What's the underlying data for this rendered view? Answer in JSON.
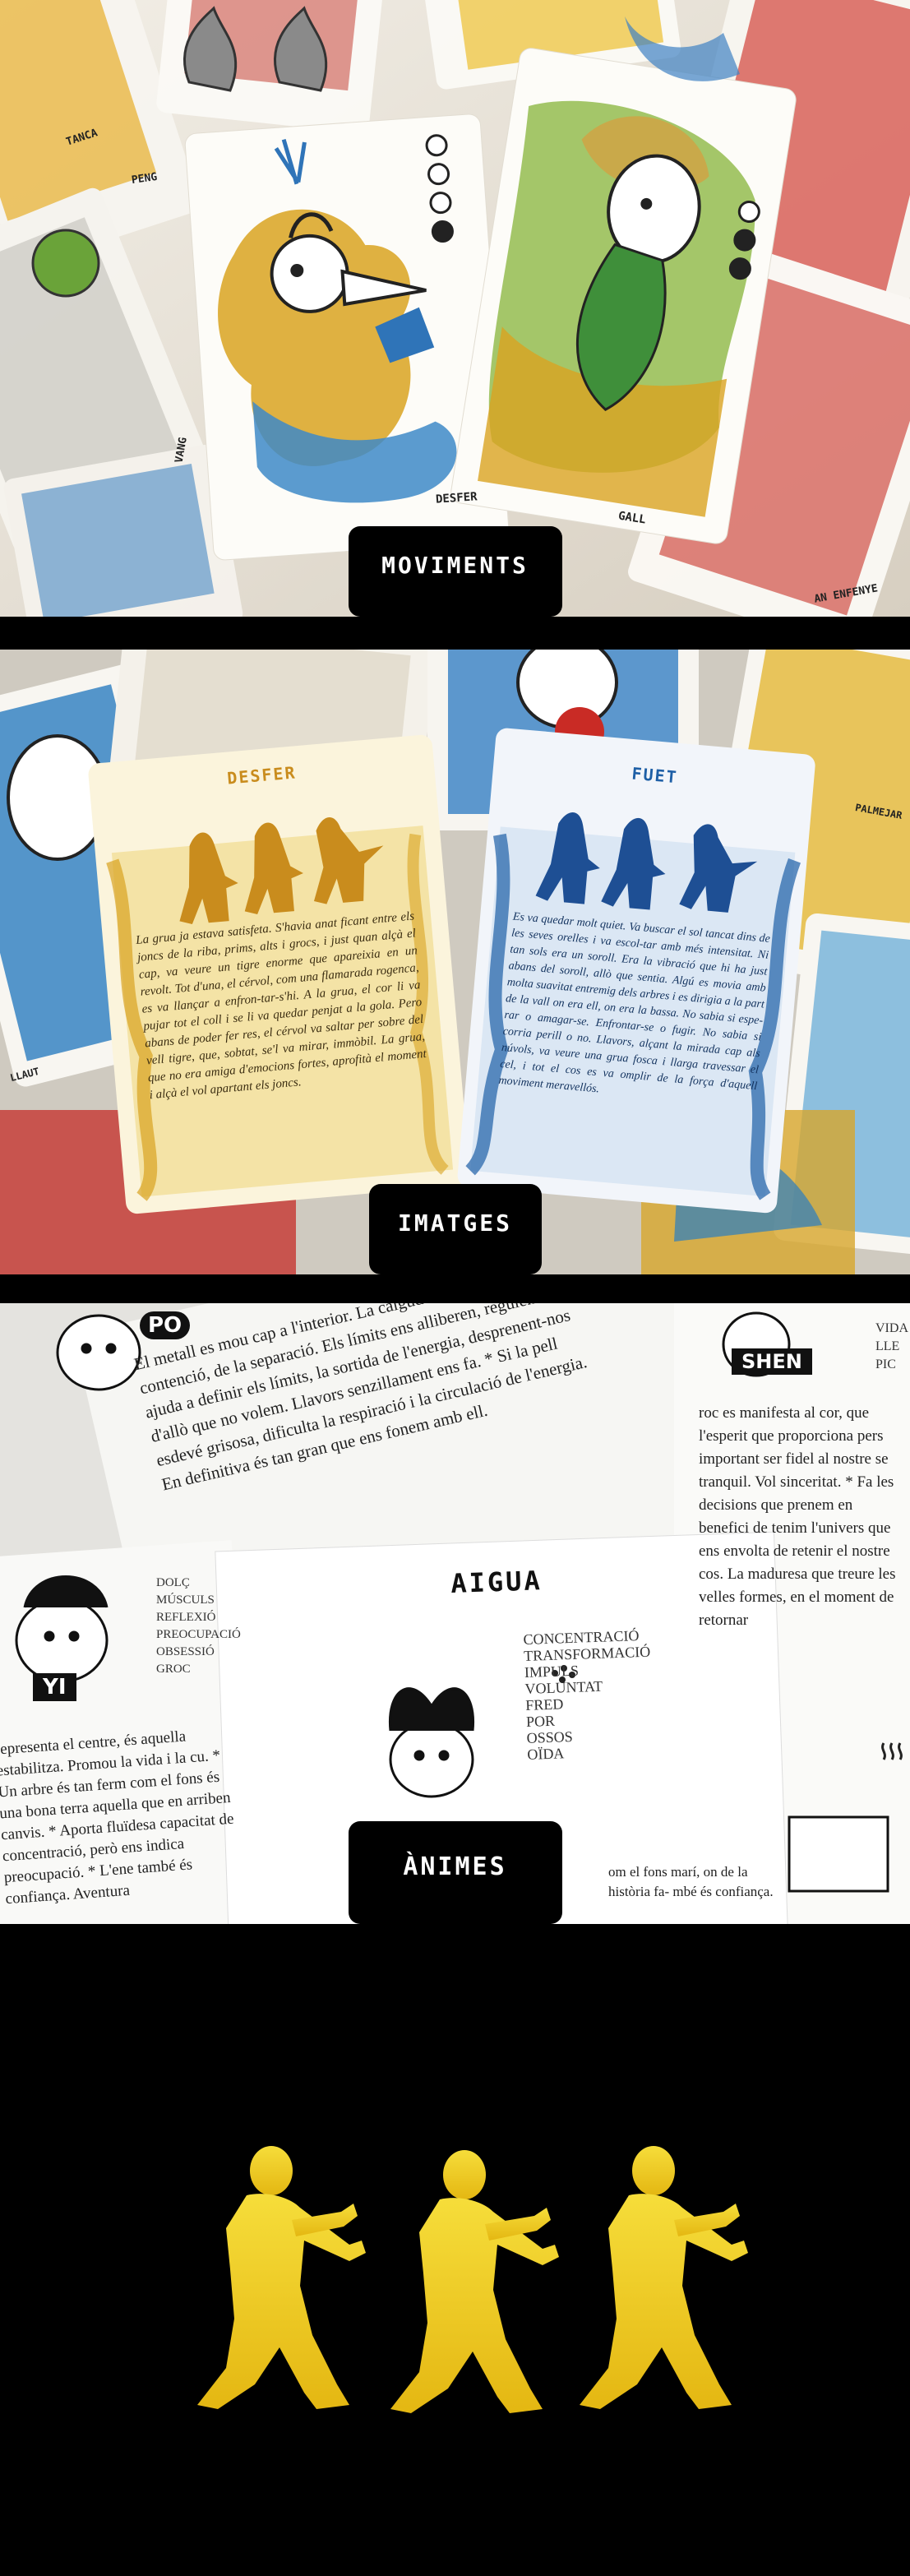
{
  "colors": {
    "background": "#000000",
    "badge_bg": "#000000",
    "badge_text": "#ffffff",
    "ochre": "#d9a321",
    "blue": "#1e5fa6",
    "figure_yellow": "#f0cf18"
  },
  "sections": {
    "moviments": {
      "label": "MOVIMENTS",
      "card_labels": [
        "DESFER",
        "GALL",
        "TANCA",
        "PENG",
        "VANG",
        "AN ENFENYE"
      ]
    },
    "imatges": {
      "label": "IMATGES",
      "card_left": {
        "title": "DESFER",
        "body": "La grua ja estava satisfeta. S'havia anat ficant entre els joncs de la riba, prims, alts i grocs, i just quan alçà el cap, va veure un tigre enorme que apareixia en un revolt. Tot d'una, el cérvol, com una flamarada rogenca, es va llançar a enfron-tar-s'hi. A la grua, el cor li va pujar tot el coll i se li va quedar penjat a la gola. Pero abans de poder fer res, el cérvol va saltar per sobre del vell tigre, que, sobtat, se'l va mirar, immòbil. La grua, que no era amiga d'emocions fortes, aprofità el moment i alçà el vol apartant els joncs."
      },
      "card_right": {
        "title": "FUET",
        "body": "Es va quedar molt quiet. Va buscar el sol tancat dins de les seves orelles i va escol-tar amb més intensitat. Ni tan sols era un soroll. Era la vibració que hi ha just abans del soroll, allò que sentia. Algú es movia amb molta suavitat entremig dels arbres i es dirigia a la part de la vall on era ell, on era la bassa. No sabia si espe-rar o amagar-se. Enfrontar-se o fugir. No sabia si corria perill o no. Llavors, alçant la mirada cap als núvols, va veure una grua fosca i llarga travessar el cel, i tot el cos es va omplir de la força d'aquell moviment meravellós."
      },
      "side_labels": [
        "PALMEJAR",
        "LLAUT"
      ]
    },
    "animes": {
      "label": "ÀNIMES",
      "page_left": "El metall es mou cap a l'interior. La caiguda vers l'interior, la contenció, de la separació. Els límits ens alliberen, regulen. * Ens ajuda a definir els límits, la sortida de l'energia, desprenent-nos d'allò que no volem. Llavors senzillament ens fa. * Si la pell esdevé grisosa, dificulta la respiració i la circulació de l'energia. En definitiva és tan gran que ens fonem amb ell.",
      "page_bottom_left": "representa el centre, és aquella estabilitza. Promou la vida i la cu. * Un arbre és tan ferm com el fons és una bona terra aquella que en arriben canvis. * Aporta fluïdesa capacitat de concentració, però ens indica preocupació. * L'ene també és confiança. Aventura",
      "page_right": "roc es manifesta al cor, que l'esperit que proporciona pers important ser fidel al nostre se tranquil. Vol sinceritat. * Fa les decisions que prenem en benefici de tenim l'univers que ens envolta de retenir el nostre cos. La maduresa que treure les velles formes, en el moment de retornar",
      "page_bottom_right": "om el fons marí, on de la història fa- mbé és confiança.",
      "list_left": [
        "DOLÇ",
        "MÚSCULS",
        "REFLEXIÓ",
        "PREOCUPACIÓ",
        "OBSESSIÓ",
        "GROC"
      ],
      "center_card": {
        "title": "AIGUA",
        "traits": [
          "CONCENTRACIÓ",
          "TRANSFORMACIÓ",
          "IMPULS",
          "VOLUNTAT",
          "FRED",
          "POR",
          "OSSOS",
          "OÏDA"
        ]
      },
      "right_list": [
        "VIDA",
        "LLE",
        "PIC"
      ],
      "char_tags": [
        "PO",
        "SHEN",
        "YI"
      ]
    },
    "figures": {
      "count": 3
    }
  }
}
